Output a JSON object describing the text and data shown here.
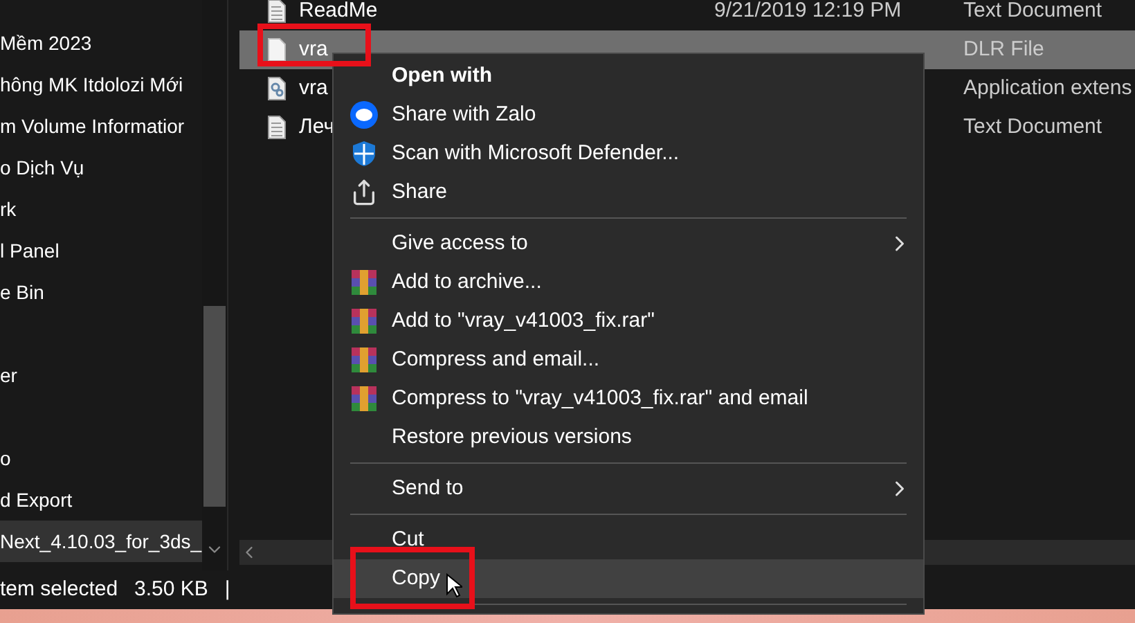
{
  "nav_pane": {
    "items": [
      {
        "label": "Mềm 2023",
        "selected": false
      },
      {
        "label": "hông MK Itdolozi Mới",
        "selected": false
      },
      {
        "label": "m Volume Informatior",
        "selected": false
      },
      {
        "label": "o Dịch Vụ",
        "selected": false
      },
      {
        "label": "rk",
        "selected": false
      },
      {
        "label": "l Panel",
        "selected": false
      },
      {
        "label": "e Bin",
        "selected": false
      },
      {
        "selected": false
      },
      {
        "label": "er",
        "selected": false
      },
      {
        "selected": false
      },
      {
        "label": "o",
        "selected": false
      },
      {
        "label": "d Export",
        "selected": false
      },
      {
        "label": "Next_4.10.03_for_3ds_",
        "selected": true
      }
    ]
  },
  "file_list": {
    "rows": [
      {
        "name": "ReadMe",
        "modified": "9/21/2019 12:19 PM",
        "type": "Text Document",
        "kind": "text",
        "selected": false
      },
      {
        "name": "vra",
        "type": "DLR File",
        "kind": "file",
        "selected": true
      },
      {
        "name": "vra",
        "type": "Application extens",
        "kind": "settings",
        "selected": false
      },
      {
        "name": "Леч",
        "type": "Text Document",
        "kind": "text",
        "selected": false
      }
    ]
  },
  "status_bar": {
    "selection": "tem selected",
    "size": "3.50 KB",
    "separator": "|"
  },
  "context_menu": {
    "items": [
      {
        "kind": "plain",
        "label": "Open with",
        "bold": true,
        "hovered": false
      },
      {
        "kind": "chat",
        "label": "Share with Zalo",
        "hovered": false
      },
      {
        "kind": "shield",
        "label": "Scan with Microsoft Defender...",
        "hovered": false
      },
      {
        "kind": "share",
        "label": "Share",
        "hovered": false
      },
      {
        "kind": "separator"
      },
      {
        "kind": "plain",
        "label": "Give access to",
        "submenu": true,
        "hovered": false
      },
      {
        "kind": "archive",
        "label": "Add to archive...",
        "hovered": false
      },
      {
        "kind": "archive",
        "label": "Add to \"vray_v41003_fix.rar\"",
        "hovered": false
      },
      {
        "kind": "archive",
        "label": "Compress and email...",
        "hovered": false
      },
      {
        "kind": "archive",
        "label": "Compress to \"vray_v41003_fix.rar\" and email",
        "hovered": false
      },
      {
        "kind": "plain",
        "label": "Restore previous versions",
        "hovered": false
      },
      {
        "kind": "separator"
      },
      {
        "kind": "plain",
        "label": "Send to",
        "submenu": true,
        "hovered": false
      },
      {
        "kind": "separator"
      },
      {
        "kind": "plain",
        "label": "Cut",
        "hovered": false
      },
      {
        "kind": "plain",
        "label": "Copy",
        "hovered": true
      },
      {
        "kind": "separator"
      }
    ]
  }
}
